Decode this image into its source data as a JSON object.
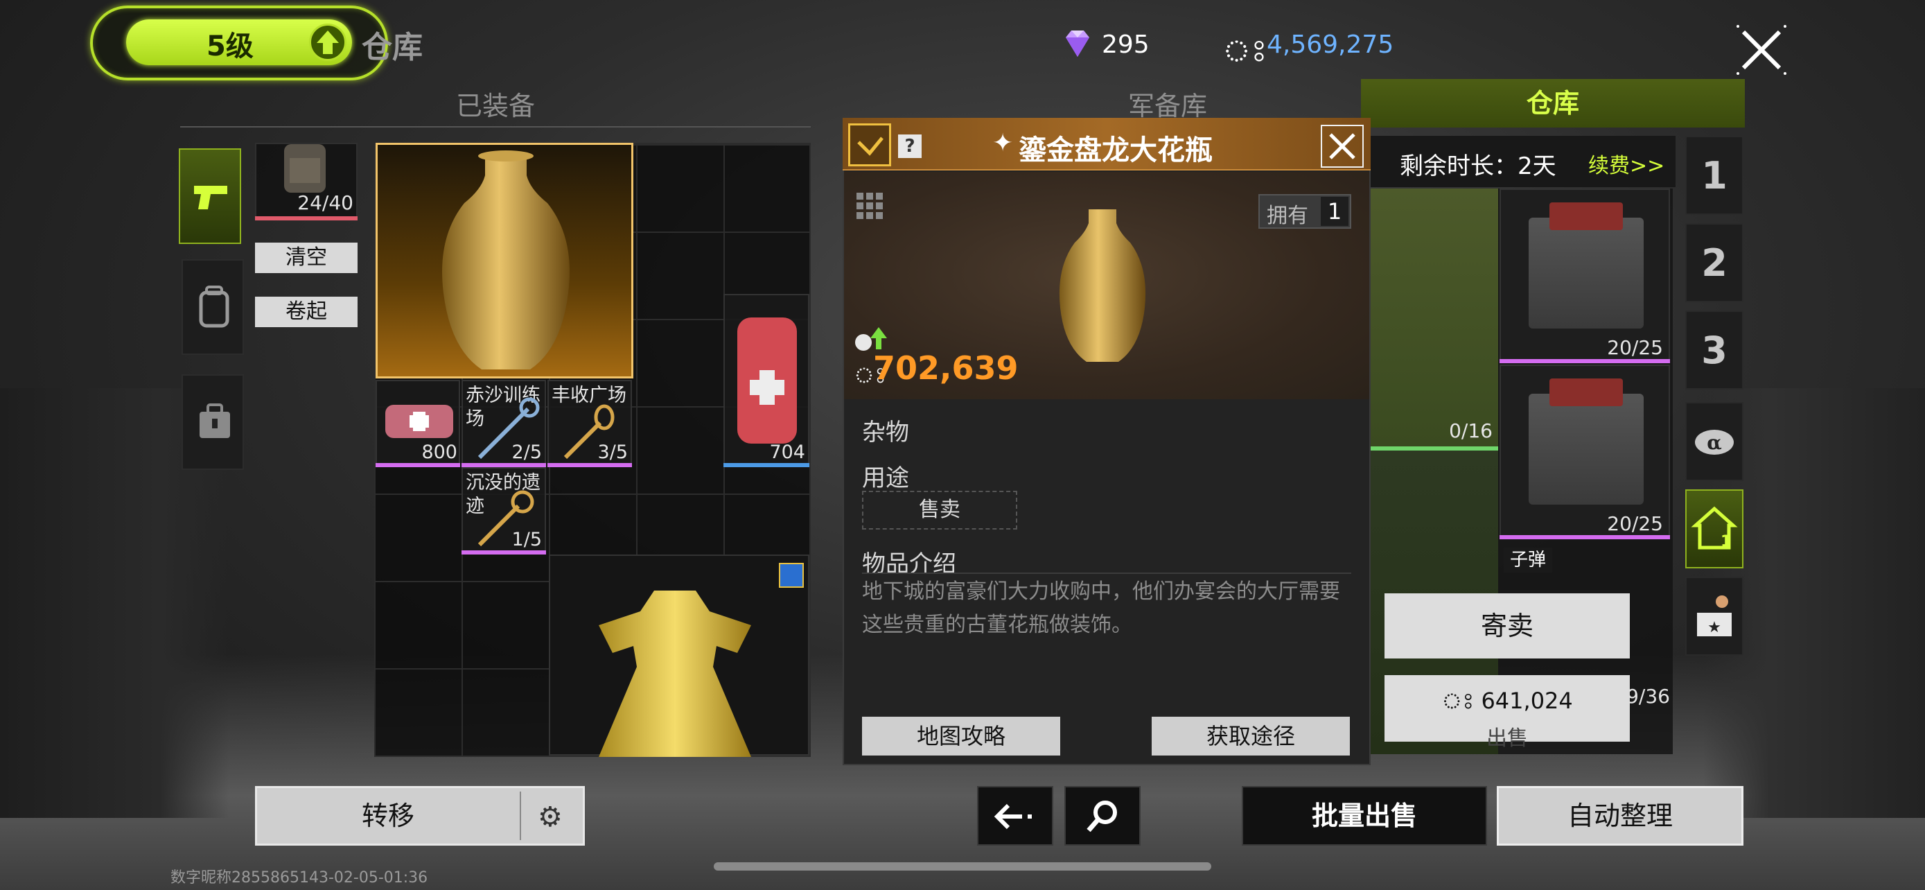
{
  "header": {
    "level": "5级",
    "title": "仓库",
    "gems": "295",
    "coins": "4,569,275"
  },
  "tabs": {
    "equipped": "已装备",
    "armory": "军备库",
    "warehouse": "仓库"
  },
  "left_panel": {
    "backpack_count": "24/40",
    "clear_label": "清空",
    "roll_label": "卷起"
  },
  "grid_items": [
    {
      "label": "",
      "count": "800"
    },
    {
      "label": "赤沙训练场",
      "count": "2/5"
    },
    {
      "label": "丰收广场",
      "count": "3/5"
    },
    {
      "label": "",
      "count": "704"
    },
    {
      "label": "沉没的遗迹",
      "count": "1/5"
    }
  ],
  "popup": {
    "title": "鎏金盘龙大花瓶",
    "owned_label": "拥有",
    "owned_count": "1",
    "price": "702,639",
    "category": "杂物",
    "use_label": "用途",
    "use_value": "售卖",
    "intro_label": "物品介绍",
    "intro_text": "地下城的富豪们大力收购中，他们办宴会的大厅需要这些贵重的古董花瓶做装饰。",
    "map_guide": "地图攻略",
    "obtain": "获取途径"
  },
  "warehouse": {
    "remain_label": "剩余时长：2天",
    "renew_label": "续费>>",
    "backpack_count": "0/16",
    "crate1_count": "20/25",
    "crate2_count": "20/25",
    "bullet_tag": "子弹",
    "bullet_count": "9/36",
    "consign_label": "寄卖",
    "sell_price": "641,024",
    "sell_label": "出售"
  },
  "num_tabs": [
    "1",
    "2",
    "3"
  ],
  "bottom": {
    "transfer": "转移",
    "batch_sell": "批量出售",
    "auto_sort": "自动整理",
    "footer_id": "数字昵称2855865143-02-05-01:36"
  },
  "colors": {
    "accent_green": "#c6f23a",
    "price_orange": "#ff9a26",
    "coin_blue": "#6fb4ff",
    "rarity_pink": "#d46cf0"
  },
  "icons": [
    "gem-icon",
    "coin-icon",
    "close-icon",
    "pistol-icon",
    "backpack-icon",
    "safe-icon",
    "check-icon",
    "help-icon",
    "grid-icon",
    "gear-icon",
    "back-arrow-icon",
    "search-icon",
    "home-icon",
    "alpha-icon",
    "shop-icon"
  ]
}
